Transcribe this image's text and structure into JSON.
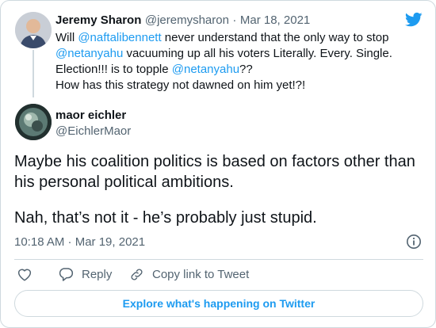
{
  "parent_tweet": {
    "name": "Jeremy Sharon",
    "handle": "@jeremysharon",
    "separator": "·",
    "date": "Mar 18, 2021",
    "text_parts": [
      {
        "t": "Will ",
        "link": false
      },
      {
        "t": "@naftalibennett",
        "link": true
      },
      {
        "t": " never understand that the only way to stop ",
        "link": false
      },
      {
        "t": "@netanyahu",
        "link": true
      },
      {
        "t": " vacuuming up all his voters Literally. Every. Single. Election!!! is to topple ",
        "link": false
      },
      {
        "t": "@netanyahu",
        "link": true
      },
      {
        "t": "??",
        "link": false
      },
      {
        "t": "\nHow has this strategy not dawned on him yet!?!",
        "link": false
      }
    ]
  },
  "main_tweet": {
    "name": "maor eichler",
    "handle": "@EichlerMaor",
    "line1": "Maybe his coalition politics is based on factors other than his personal political ambitions.",
    "line2": "Nah, that’s not it - he’s probably just stupid.",
    "time": "10:18 AM · Mar 19, 2021"
  },
  "actions": {
    "reply_label": "Reply",
    "copy_label": "Copy link to Tweet"
  },
  "explore_label": "Explore what's happening on Twitter",
  "colors": {
    "link": "#1d9bf0",
    "border": "#cfd9de",
    "muted": "#536471",
    "text": "#0f1419"
  },
  "icons": [
    "twitter-bird-icon",
    "info-icon",
    "heart-icon",
    "reply-icon",
    "link-icon"
  ]
}
